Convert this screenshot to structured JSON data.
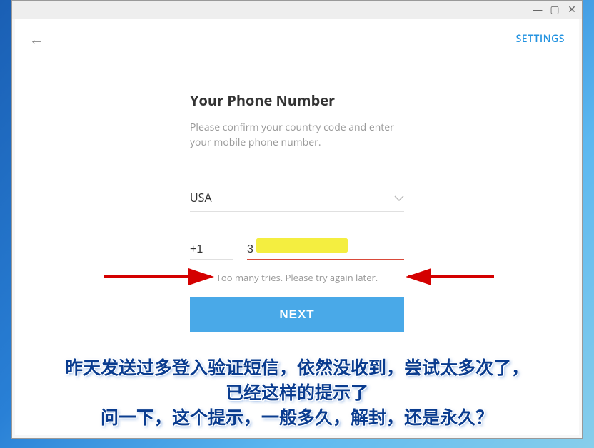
{
  "titlebar": {
    "minimize": "—",
    "maximize": "▢",
    "close": "✕"
  },
  "topbar": {
    "back": "←",
    "settings": "SETTINGS"
  },
  "form": {
    "heading": "Your Phone Number",
    "subtext": "Please confirm your country code and enter your mobile phone number.",
    "country": "USA",
    "code_value": "+1",
    "phone_value": "3",
    "error": "Too many tries. Please try again later.",
    "next": "NEXT"
  },
  "annotation": {
    "line1": "昨天发送过多登入验证短信，依然没收到，尝试太多次了，",
    "line2": "已经这样的提示了",
    "line3": "问一下，这个提示，一般多久，解封，还是永久？"
  }
}
